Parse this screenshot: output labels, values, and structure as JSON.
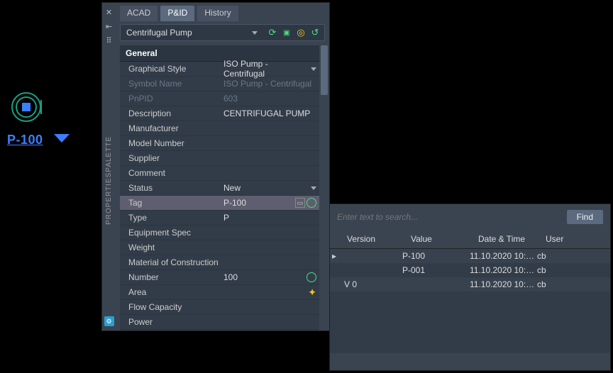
{
  "canvas": {
    "pump_label": "P-100"
  },
  "palette": {
    "title_vertical": "PROPERTIESPALETTE",
    "tabs": {
      "acad": "ACAD",
      "pid": "P&ID",
      "history": "History"
    },
    "type_select": "Centrifugal Pump",
    "group": "General",
    "rows": {
      "graphical_style": {
        "label": "Graphical Style",
        "value": "ISO Pump - Centrifugal"
      },
      "symbol_name": {
        "label": "Symbol Name",
        "value": "ISO Pump - Centrifugal"
      },
      "pnpid": {
        "label": "PnPID",
        "value": "603"
      },
      "description": {
        "label": "Description",
        "value": "CENTRIFUGAL PUMP"
      },
      "manufacturer": {
        "label": "Manufacturer",
        "value": ""
      },
      "model_number": {
        "label": "Model Number",
        "value": ""
      },
      "supplier": {
        "label": "Supplier",
        "value": ""
      },
      "comment": {
        "label": "Comment",
        "value": ""
      },
      "status": {
        "label": "Status",
        "value": "New"
      },
      "tag": {
        "label": "Tag",
        "value": "P-100"
      },
      "type": {
        "label": "Type",
        "value": "P"
      },
      "equipment_spec": {
        "label": "Equipment Spec",
        "value": ""
      },
      "weight": {
        "label": "Weight",
        "value": ""
      },
      "moc": {
        "label": "Material of Construction",
        "value": ""
      },
      "number": {
        "label": "Number",
        "value": "100"
      },
      "area": {
        "label": "Area",
        "value": ""
      },
      "flow_capacity": {
        "label": "Flow Capacity",
        "value": ""
      },
      "power": {
        "label": "Power",
        "value": ""
      }
    }
  },
  "history": {
    "search_placeholder": "Enter text to search...",
    "find_label": "Find",
    "columns": {
      "version": "Version",
      "value": "Value",
      "datetime": "Date & Time",
      "user": "User"
    },
    "rows": [
      {
        "version": "",
        "value": "P-100",
        "datetime": "11.10.2020 10:…",
        "user": "cb"
      },
      {
        "version": "",
        "value": "P-001",
        "datetime": "11.10.2020 10:…",
        "user": "cb"
      },
      {
        "version": "V 0",
        "value": "",
        "datetime": "11.10.2020 10:…",
        "user": "cb"
      }
    ]
  }
}
